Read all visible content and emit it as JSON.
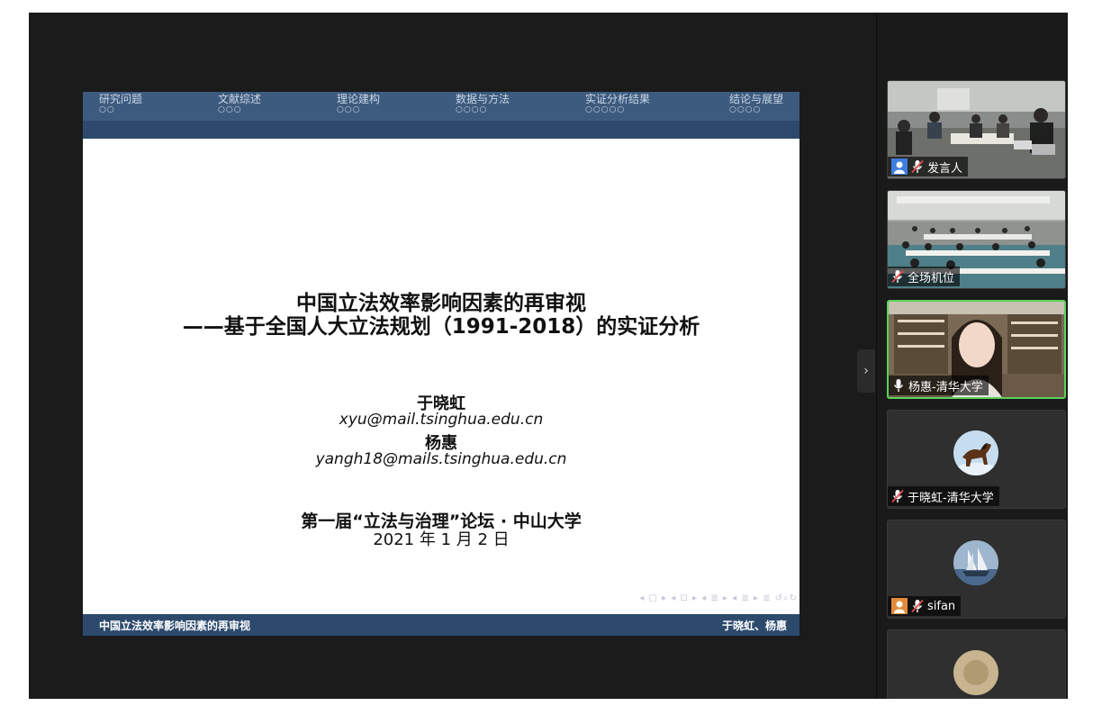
{
  "slide": {
    "nav": [
      {
        "label": "研究问题",
        "dots": "○○"
      },
      {
        "label": "文献综述",
        "dots": "○○○"
      },
      {
        "label": "理论建构",
        "dots": "○○○"
      },
      {
        "label": "数据与方法",
        "dots": "○○○○"
      },
      {
        "label": "实证分析结果",
        "dots": "○○○○○"
      },
      {
        "label": "结论与展望",
        "dots": "○○○○"
      }
    ],
    "title_line1": "中国立法效率影响因素的再审视",
    "title_line2": "——基于全国人大立法规划（1991-2018）的实证分析",
    "author1": "于晓虹",
    "email1": "xyu@mail.tsinghua.edu.cn",
    "author2": "杨惠",
    "email2": "yangh18@mails.tsinghua.edu.cn",
    "conference": "第一届“立法与治理”论坛 · 中山大学",
    "date": "2021 年 1 月 2 日",
    "beamer_nav": "◂ □ ▸ ◂ ⊡ ▸ ◂ ≣ ▸ ◂ ≣ ▸   ≣   ↺⌕↻",
    "footer_left": "中国立法效率影响因素的再审视",
    "footer_right": "于晓虹、杨惠"
  },
  "panel": {
    "toggle_glyph": "›",
    "participants": [
      {
        "name": "发言人",
        "mic": "muted",
        "type": "video-meeting-room",
        "user_icon": true
      },
      {
        "name": "全场机位",
        "mic": "muted",
        "type": "video-conference-hall"
      },
      {
        "name": "杨惠-清华大学",
        "mic": "active",
        "type": "video-person",
        "speaking": true
      },
      {
        "name": "于晓虹-清华大学",
        "mic": "muted",
        "type": "avatar-horse"
      },
      {
        "name": "sifan",
        "mic": "muted",
        "type": "avatar-ship",
        "user_icon": true
      },
      {
        "name": "",
        "mic": "muted",
        "type": "avatar-partial"
      }
    ]
  },
  "colors": {
    "slide_band": "#3d5b7e",
    "slide_band_dark": "#2d4a6d",
    "speaking_border": "#5ad35a",
    "app_bg": "#1b1b1b"
  }
}
